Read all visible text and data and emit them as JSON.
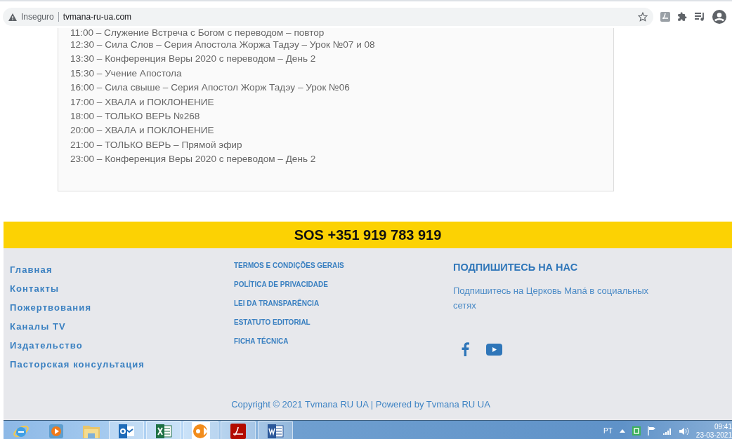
{
  "address_bar": {
    "security": "Inseguro",
    "url": "tvmana-ru-ua.com"
  },
  "schedule": [
    "11:00 – Служение Встреча с Богом с переводом – повтор",
    "12:30 – Сила Слов – Серия Апостола Жоржа Тадэу – Урок №07 и 08",
    "13:30 – Конференция Веры 2020 с переводом – День 2",
    "15:30 – Учение Апостола",
    "16:00 – Сила свыше – Серия Апостол Жорж Тадэу – Урок №06",
    "17:00 – ХВАЛА и ПОКЛОНЕНИЕ",
    "18:00 – ТОЛЬКО ВЕРЬ №268",
    "20:00 – ХВАЛА и ПОКЛОНЕНИЕ",
    "21:00 – ТОЛЬКО ВЕРЬ – Прямой эфир",
    "23:00 – Конференция Веры 2020 с переводом – День 2"
  ],
  "sos_banner": "SOS +351 919 783 919",
  "footer": {
    "nav_links": [
      "Главная",
      "Контакты",
      "Пожертвования",
      "Каналы TV",
      "Издательство",
      "Пасторская консультация"
    ],
    "legal_links": [
      "TERMOS E CONDIÇÕES GERAIS",
      "POLÍTICA DE PRIVACIDADE",
      "LEI DA TRANSPARÊNCIA",
      "ESTATUTO EDITORIAL",
      "FICHA TÉCNICA"
    ],
    "subscribe": {
      "heading": "ПОДПИШИТЕСЬ НА НАС",
      "text": "Подпишитесь на Церковь Maná в социальных сетях",
      "social": [
        {
          "kind": "facebook"
        },
        {
          "kind": "youtube"
        }
      ]
    },
    "copyright": "Copyright © 2021 Tvmana RU UA | Powered by Tvmana RU UA"
  },
  "taskbar": {
    "apps": [
      {
        "kind": "ie"
      },
      {
        "kind": "media"
      },
      {
        "kind": "folder"
      },
      {
        "kind": "outlook"
      },
      {
        "kind": "excel"
      },
      {
        "kind": "orange"
      },
      {
        "kind": "acrobat"
      },
      {
        "kind": "word"
      }
    ],
    "language": "PT",
    "time": "09:41",
    "date": "23-03-2021"
  }
}
